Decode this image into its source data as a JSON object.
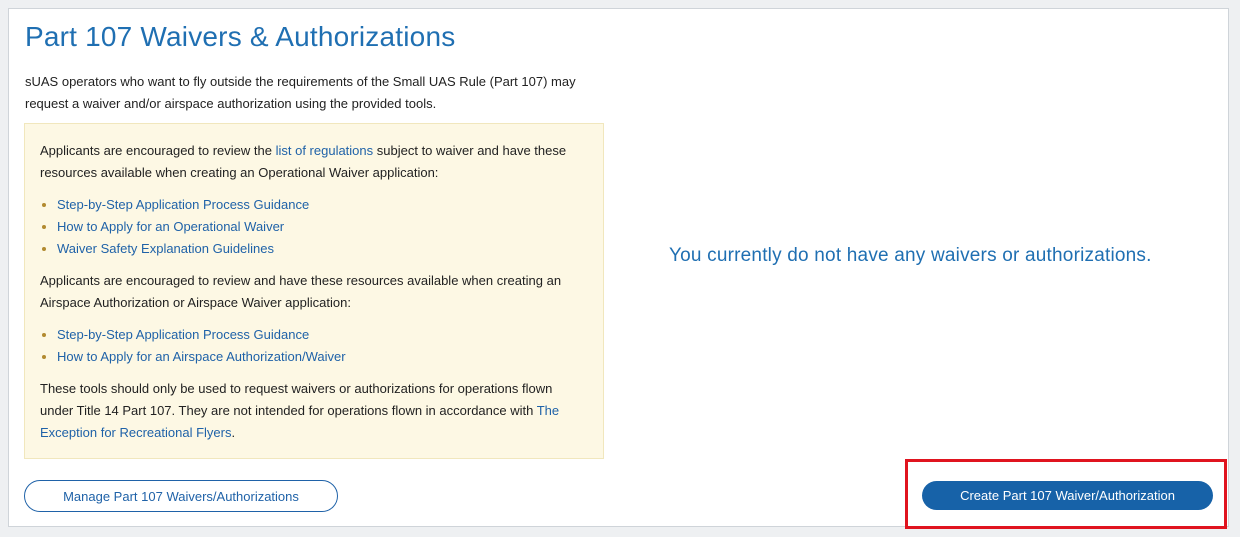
{
  "page": {
    "title": "Part 107 Waivers & Authorizations",
    "intro": "sUAS operators who want to fly outside the requirements of the Small UAS Rule (Part 107) may request a waiver and/or airspace authorization using the provided tools."
  },
  "notice": {
    "para1_before": "Applicants are encouraged to review the ",
    "para1_link": "list of regulations",
    "para1_after": " subject to waiver and have these resources available when creating an Operational Waiver application:",
    "operational_links": [
      "Step-by-Step Application Process Guidance",
      "How to Apply for an Operational Waiver",
      "Waiver Safety Explanation Guidelines"
    ],
    "para2": "Applicants are encouraged to review and have these resources available when creating an Airspace Authorization or Airspace Waiver application:",
    "airspace_links": [
      "Step-by-Step Application Process Guidance",
      "How to Apply for an Airspace Authorization/Waiver"
    ],
    "para3_before": "These tools should only be used to request waivers or authorizations for operations flown under Title 14 Part 107. They are not intended for operations flown in accordance with ",
    "para3_link": "The Exception for Recreational Flyers",
    "para3_after": "."
  },
  "empty_state": {
    "message": "You currently do not have any waivers or authorizations."
  },
  "actions": {
    "manage_label": "Manage Part 107 Waivers/Authorizations",
    "create_label": "Create Part 107 Waiver/Authorization"
  },
  "colors": {
    "accent": "#1f6fb2",
    "notice_bg": "#fdf8e4",
    "primary_button": "#1762a8",
    "highlight": "#e0141f"
  }
}
